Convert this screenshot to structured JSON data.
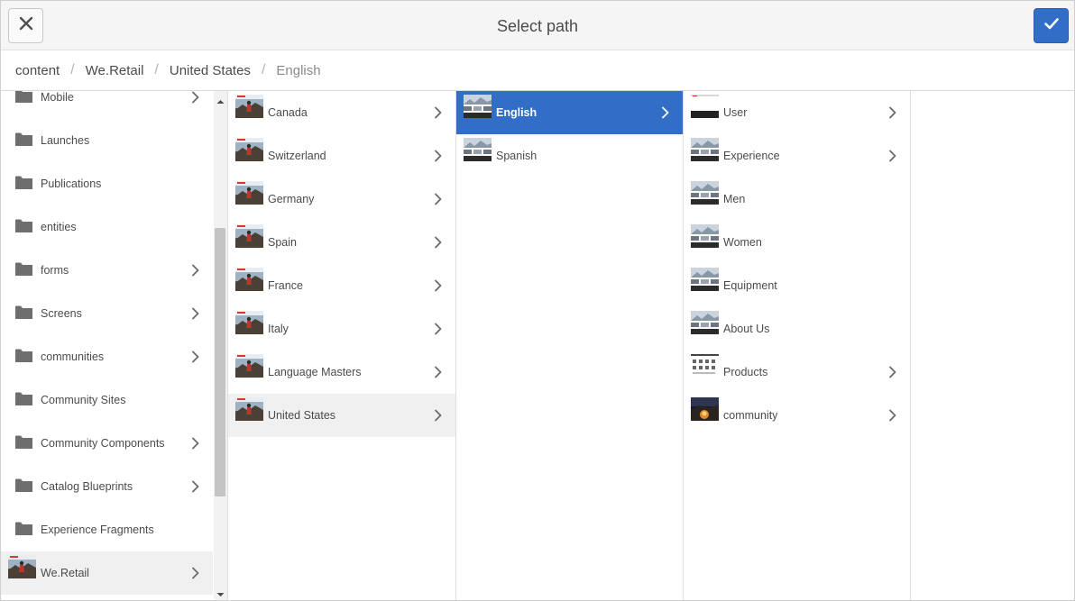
{
  "dialog": {
    "title": "Select path",
    "close_icon": "close-icon",
    "confirm_icon": "checkmark-icon",
    "accent_color": "#326ec8"
  },
  "breadcrumb": [
    "content",
    "We.Retail",
    "United States",
    "English"
  ],
  "columns": {
    "sites": {
      "items": [
        {
          "label": "Mobile",
          "icon": "folder-icon",
          "chevron": true
        },
        {
          "label": "Launches",
          "icon": "folder-icon",
          "chevron": false
        },
        {
          "label": "Publications",
          "icon": "folder-icon",
          "chevron": false
        },
        {
          "label": "entities",
          "icon": "folder-icon",
          "chevron": false
        },
        {
          "label": "forms",
          "icon": "folder-icon",
          "chevron": true
        },
        {
          "label": "Screens",
          "icon": "folder-icon",
          "chevron": true
        },
        {
          "label": "communities",
          "icon": "folder-icon",
          "chevron": true
        },
        {
          "label": "Community Sites",
          "icon": "folder-icon",
          "chevron": false
        },
        {
          "label": "Community Components",
          "icon": "folder-icon",
          "chevron": true
        },
        {
          "label": "Catalog Blueprints",
          "icon": "folder-icon",
          "chevron": true
        },
        {
          "label": "Experience Fragments",
          "icon": "folder-icon",
          "chevron": false
        },
        {
          "label": "We.Retail",
          "icon": "page-thumbnail",
          "chevron": true,
          "active": true
        }
      ]
    },
    "countries": {
      "items": [
        {
          "label": "Canada",
          "chevron": true
        },
        {
          "label": "Switzerland",
          "chevron": true
        },
        {
          "label": "Germany",
          "chevron": true
        },
        {
          "label": "Spain",
          "chevron": true
        },
        {
          "label": "France",
          "chevron": true
        },
        {
          "label": "Italy",
          "chevron": true
        },
        {
          "label": "Language Masters",
          "chevron": true
        },
        {
          "label": "United States",
          "chevron": true,
          "active": true
        }
      ]
    },
    "languages": {
      "items": [
        {
          "label": "English",
          "chevron": true,
          "selected": true
        },
        {
          "label": "Spanish",
          "chevron": false
        }
      ]
    },
    "pages": {
      "items": [
        {
          "label": "User",
          "chevron": true
        },
        {
          "label": "Experience",
          "chevron": true
        },
        {
          "label": "Men",
          "chevron": false
        },
        {
          "label": "Women",
          "chevron": false
        },
        {
          "label": "Equipment",
          "chevron": false
        },
        {
          "label": "About Us",
          "chevron": false
        },
        {
          "label": "Products",
          "chevron": true
        },
        {
          "label": "community",
          "chevron": true
        }
      ]
    }
  }
}
